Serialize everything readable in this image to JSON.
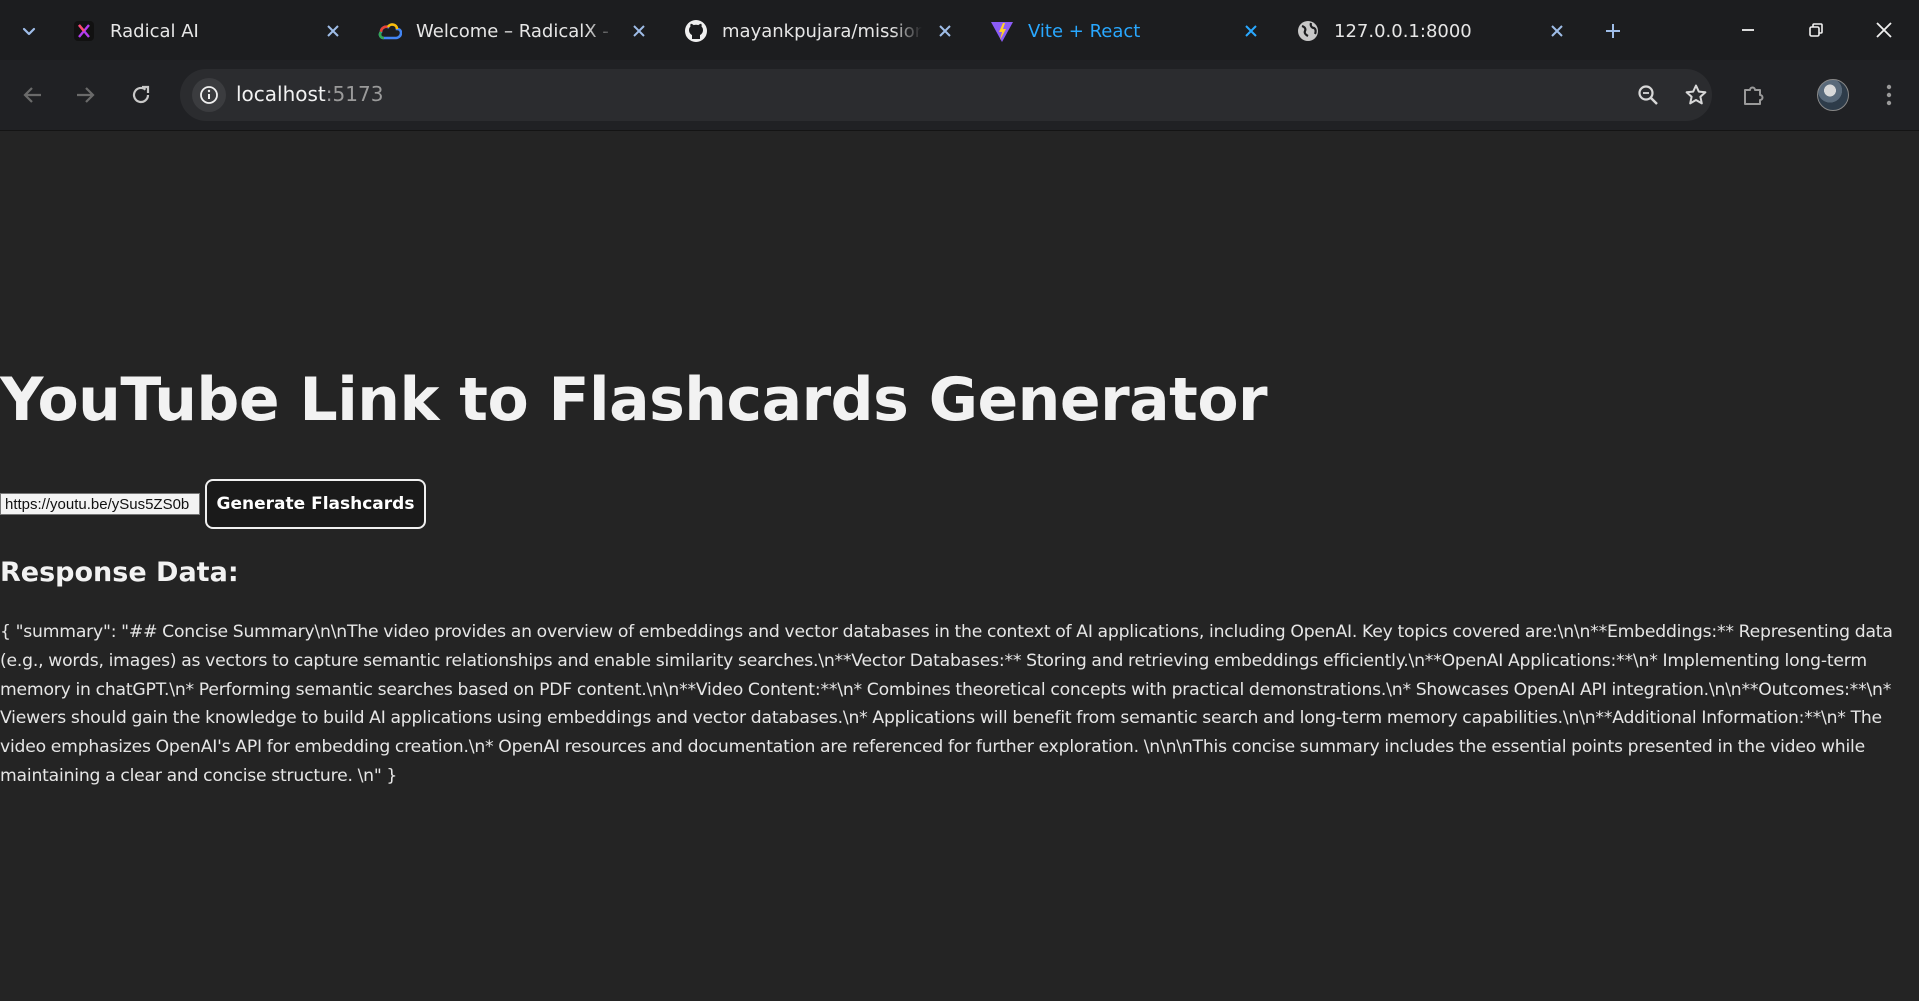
{
  "browser": {
    "tabs": [
      {
        "title": "Radical AI",
        "icon": "radical-ai-logo"
      },
      {
        "title": "Welcome – RadicalX - Ge",
        "icon": "google-cloud-logo"
      },
      {
        "title": "mayankpujara/mission-q",
        "icon": "github-logo"
      },
      {
        "title": "Vite + React",
        "icon": "vite-logo",
        "active": true
      },
      {
        "title": "127.0.0.1:8000",
        "icon": "globe-icon"
      }
    ],
    "url_host": "localhost",
    "url_port": ":5173",
    "accent_color": "#29a8ff"
  },
  "app": {
    "title": "YouTube Link to Flashcards Generator",
    "input": {
      "value": "https://youtu.be/ySus5ZS0b",
      "placeholder": ""
    },
    "generate_label": "Generate Flashcards",
    "response_heading": "Response Data:",
    "response_text": "{ \"summary\": \"## Concise Summary\\n\\nThe video provides an overview of embeddings and vector databases in the context of AI applications, including OpenAI. Key topics covered are:\\n\\n**Embeddings:** Representing data (e.g., words, images) as vectors to capture semantic relationships and enable similarity searches.\\n**Vector Databases:** Storing and retrieving embeddings efficiently.\\n**OpenAI Applications:**\\n* Implementing long-term memory in chatGPT.\\n* Performing semantic searches based on PDF content.\\n\\n**Video Content:**\\n* Combines theoretical concepts with practical demonstrations.\\n* Showcases OpenAI API integration.\\n\\n**Outcomes:**\\n* Viewers should gain the knowledge to build AI applications using embeddings and vector databases.\\n* Applications will benefit from semantic search and long-term memory capabilities.\\n\\n**Additional Information:**\\n* The video emphasizes OpenAI's API for embedding creation.\\n* OpenAI resources and documentation are referenced for further exploration. \\n\\n\\nThis concise summary includes the essential points presented in the video while maintaining a clear and concise structure. \\n\" }"
  }
}
